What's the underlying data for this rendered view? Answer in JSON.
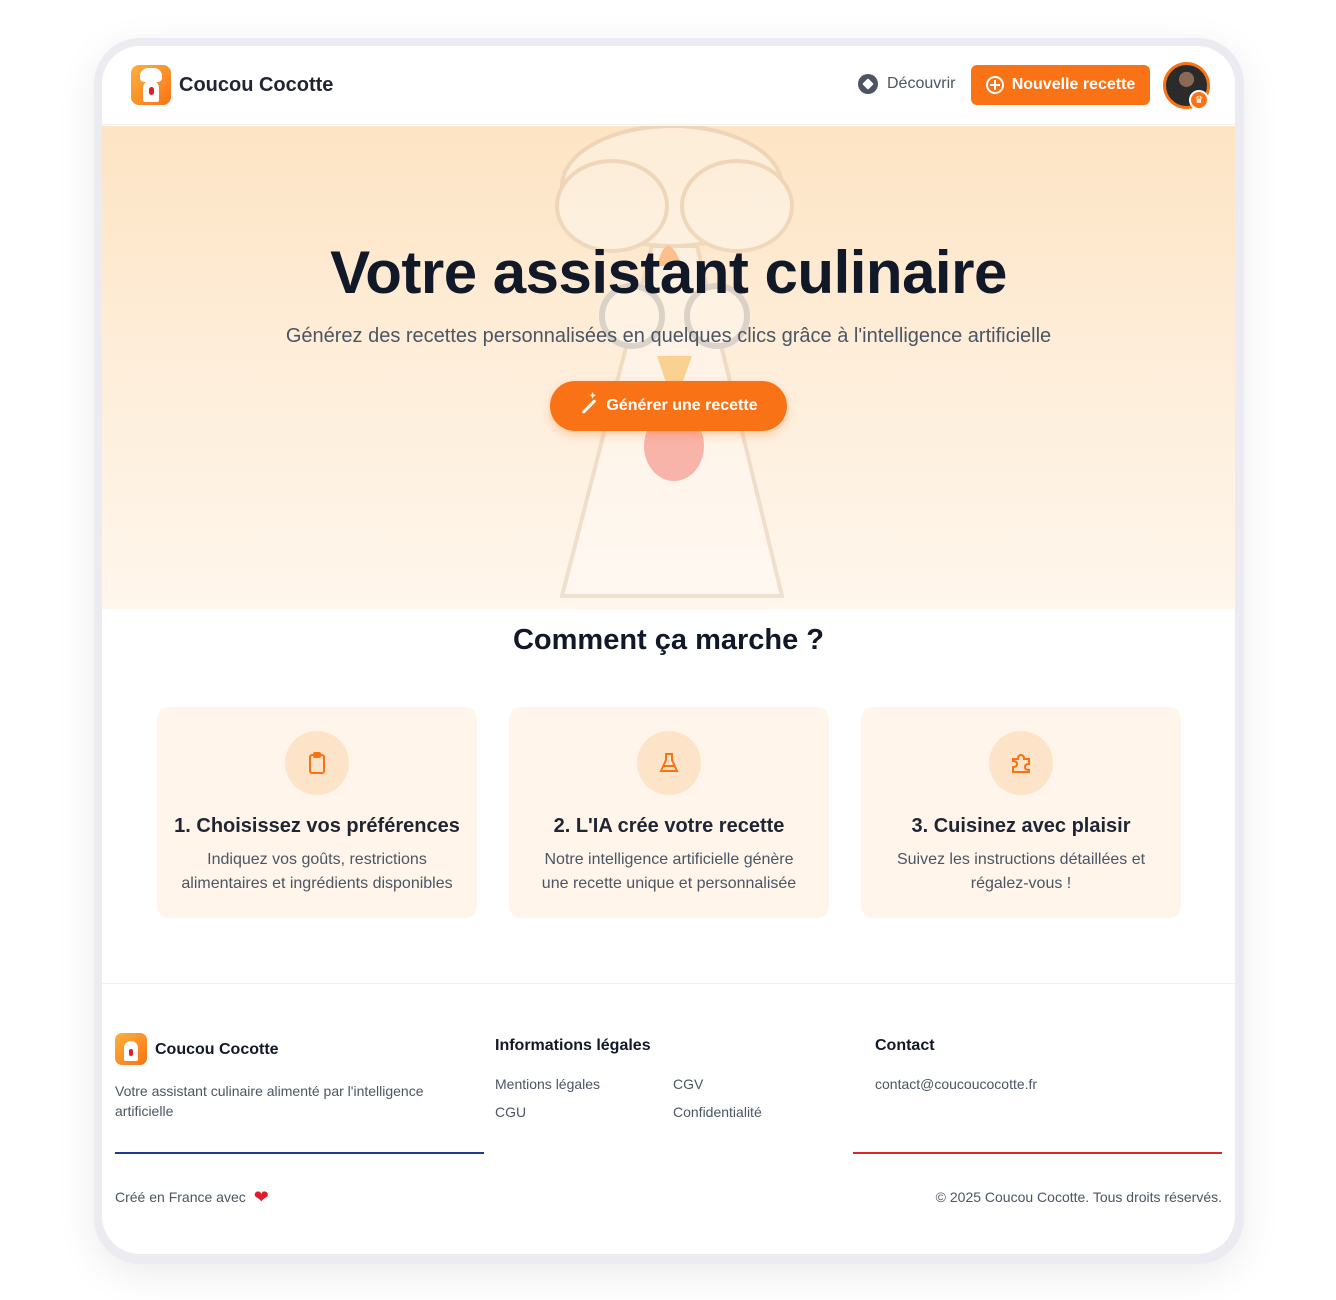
{
  "header": {
    "brand": "Coucou Cocotte",
    "discover_label": "Découvrir",
    "new_recipe_label": "Nouvelle recette"
  },
  "hero": {
    "title": "Votre assistant culinaire",
    "subtitle": "Générez des recettes personnalisées en quelques clics grâce à l'intelligence artificielle",
    "cta_label": "Générer une recette"
  },
  "how": {
    "title": "Comment ça marche ?",
    "steps": [
      {
        "title": "1. Choisissez vos préférences",
        "text": "Indiquez vos goûts, restrictions alimentaires et ingrédients disponibles",
        "icon": "clipboard-icon"
      },
      {
        "title": "2. L'IA crée votre recette",
        "text": "Notre intelligence artificielle génère une recette unique et personnalisée",
        "icon": "flask-icon"
      },
      {
        "title": "3. Cuisinez avec plaisir",
        "text": "Suivez les instructions détaillées et régalez-vous !",
        "icon": "puzzle-icon"
      }
    ]
  },
  "footer": {
    "brand": "Coucou Cocotte",
    "description": "Votre assistant culinaire alimenté par l'intelligence artificielle",
    "legal_heading": "Informations légales",
    "legal_links": [
      "Mentions légales",
      "CGV",
      "CGU",
      "Confidentialité"
    ],
    "contact_heading": "Contact",
    "contact_email": "contact@coucoucocotte.fr",
    "made_in": "Créé en France avec",
    "copyright": "© 2025 Coucou Cocotte. Tous droits réservés."
  },
  "colors": {
    "accent": "#f97316",
    "flag_blue": "#1e3a8a",
    "flag_red": "#dc2626"
  }
}
